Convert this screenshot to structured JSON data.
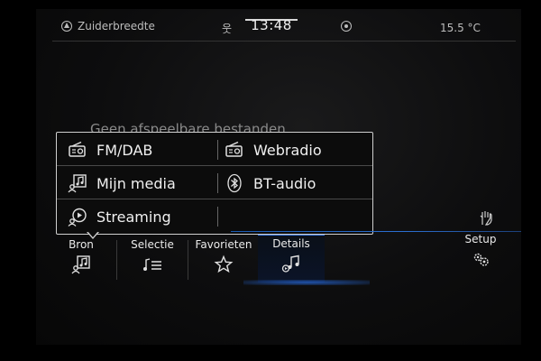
{
  "status": {
    "location": "Zuiderbreedte",
    "time": "13:48",
    "temperature": "15.5 °C"
  },
  "background_message": "Geen afspeelbare bestanden",
  "source_menu": {
    "items": [
      {
        "label": "FM/DAB",
        "icon": "radio-icon"
      },
      {
        "label": "Webradio",
        "icon": "webradio-icon"
      },
      {
        "label": "Mijn media",
        "icon": "media-icon"
      },
      {
        "label": "BT-audio",
        "icon": "bluetooth-icon"
      },
      {
        "label": "Streaming",
        "icon": "streaming-icon"
      }
    ]
  },
  "bottom_tabs": [
    {
      "label": "Bron",
      "icon": "source-icon",
      "active": false
    },
    {
      "label": "Selectie",
      "icon": "selection-list-icon",
      "active": false
    },
    {
      "label": "Favorieten",
      "icon": "star-icon",
      "active": false
    },
    {
      "label": "Details",
      "icon": "details-icon",
      "active": true
    },
    {
      "label": "Setup",
      "icon": "gears-icon",
      "active": false
    }
  ],
  "colors": {
    "accent_blue": "#2b6fd1",
    "text": "#f0f0f0",
    "muted": "#8a8a8a"
  }
}
